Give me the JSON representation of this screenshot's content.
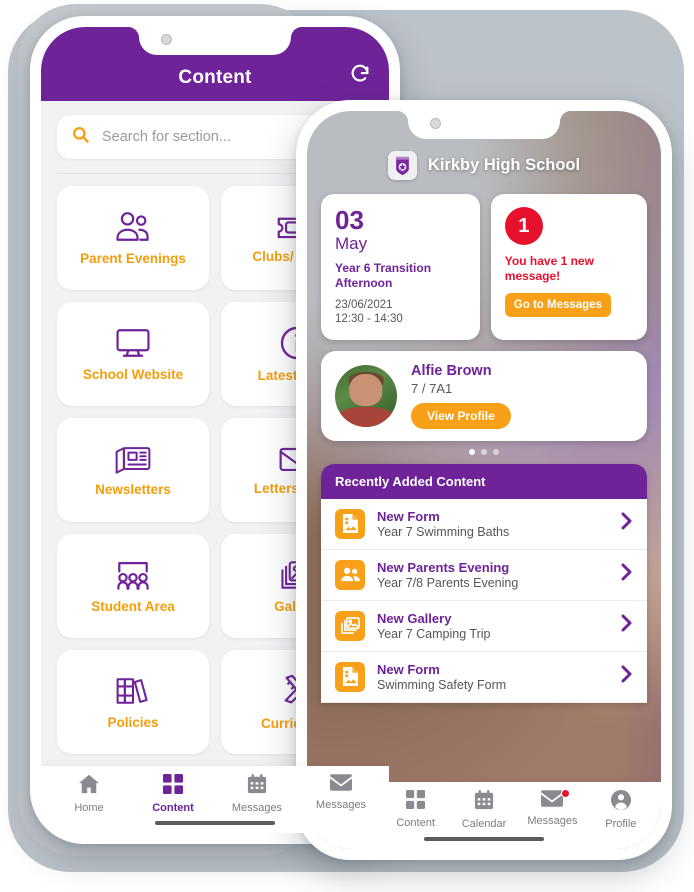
{
  "left_phone": {
    "header": {
      "title": "Content",
      "refresh_icon": "refresh-icon"
    },
    "search": {
      "placeholder": "Search for section...",
      "icon": "search-icon"
    },
    "tiles": [
      {
        "label": "Parent Evenings",
        "icon": "people-icon"
      },
      {
        "label": "Clubs/ Events",
        "icon": "ticket-icon"
      },
      {
        "label": "School Website",
        "icon": "monitor-icon"
      },
      {
        "label": "Latest News",
        "icon": "info-circle-icon"
      },
      {
        "label": "Newsletters",
        "icon": "newspaper-icon"
      },
      {
        "label": "Letters Home",
        "icon": "envelope-icon"
      },
      {
        "label": "Student Area",
        "icon": "classroom-icon"
      },
      {
        "label": "Gallery",
        "icon": "photos-icon"
      },
      {
        "label": "Policies",
        "icon": "books-icon"
      },
      {
        "label": "Curriculum",
        "icon": "pencil-ruler-icon"
      }
    ],
    "tabs": [
      {
        "label": "Home",
        "icon": "home-icon",
        "active": false
      },
      {
        "label": "Content",
        "icon": "grid-icon",
        "active": true
      },
      {
        "label": "Calendar",
        "icon": "calendar-icon",
        "active": false
      },
      {
        "label": "Messages",
        "icon": "envelope-icon",
        "active": false
      }
    ]
  },
  "right_phone": {
    "school": {
      "name": "Kirkby High School",
      "logo_icon": "school-crest-icon"
    },
    "date_card": {
      "day": "03",
      "month": "May",
      "event": "Year 6 Transition Afternoon",
      "date": "23/06/2021",
      "time": "12:30 - 14:30"
    },
    "message_card": {
      "count": "1",
      "text": "You have 1 new message!",
      "button": "Go to Messages"
    },
    "student_card": {
      "name": "Alfie Brown",
      "class": "7 / 7A1",
      "button": "View Profile",
      "avatar_icon": "student-avatar"
    },
    "carousel_dots": 3,
    "carousel_active": 0,
    "recent": {
      "heading": "Recently Added Content",
      "items": [
        {
          "title": "New Form",
          "subtitle": "Year 7 Swimming Baths",
          "icon": "form-icon",
          "chevron": "chevron-right-icon"
        },
        {
          "title": "New Parents Evening",
          "subtitle": "Year 7/8 Parents Evening",
          "icon": "people-icon",
          "chevron": "chevron-right-icon"
        },
        {
          "title": "New Gallery",
          "subtitle": "Year 7 Camping Trip",
          "icon": "photos-icon",
          "chevron": "chevron-right-icon"
        },
        {
          "title": "New Form",
          "subtitle": "Swimming Safety Form",
          "icon": "form-icon",
          "chevron": "chevron-right-icon"
        }
      ]
    },
    "tabs": [
      {
        "label": "Home",
        "icon": "home-icon",
        "active": true,
        "badge": false
      },
      {
        "label": "Content",
        "icon": "grid-icon",
        "active": false,
        "badge": false
      },
      {
        "label": "Calendar",
        "icon": "calendar-icon",
        "active": false,
        "badge": false
      },
      {
        "label": "Messages",
        "icon": "envelope-icon",
        "active": false,
        "badge": true
      },
      {
        "label": "Profile",
        "icon": "person-circle-icon",
        "active": false,
        "badge": false
      }
    ]
  },
  "colors": {
    "purple": "#6F2399",
    "orange": "#F9A019",
    "tile_label": "#F59E0B",
    "red": "#E8112D",
    "screen_bg": "#F2F2F3",
    "backdrop": "#BCC3C9"
  }
}
